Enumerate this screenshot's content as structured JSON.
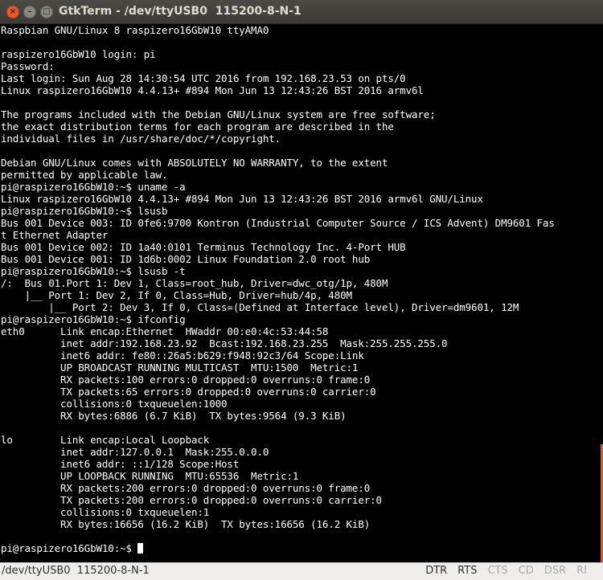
{
  "window": {
    "title": "GtkTerm - /dev/ttyUSB0  115200-8-N-1",
    "buttons": {
      "close": "×",
      "minimize": "–",
      "maximize": "□"
    }
  },
  "terminal": {
    "lines": [
      "Raspbian GNU/Linux 8 raspizero16GbW10 ttyAMA0",
      "",
      "raspizero16GbW10 login: pi",
      "Password:",
      "Last login: Sun Aug 28 14:30:54 UTC 2016 from 192.168.23.53 on pts/0",
      "Linux raspizero16GbW10 4.4.13+ #894 Mon Jun 13 12:43:26 BST 2016 armv6l",
      "",
      "The programs included with the Debian GNU/Linux system are free software;",
      "the exact distribution terms for each program are described in the",
      "individual files in /usr/share/doc/*/copyright.",
      "",
      "Debian GNU/Linux comes with ABSOLUTELY NO WARRANTY, to the extent",
      "permitted by applicable law.",
      "pi@raspizero16GbW10:~$ uname -a",
      "Linux raspizero16GbW10 4.4.13+ #894 Mon Jun 13 12:43:26 BST 2016 armv6l GNU/Linux",
      "pi@raspizero16GbW10:~$ lsusb",
      "Bus 001 Device 003: ID 0fe6:9700 Kontron (Industrial Computer Source / ICS Advent) DM9601 Fas",
      "t Ethernet Adapter",
      "Bus 001 Device 002: ID 1a40:0101 Terminus Technology Inc. 4-Port HUB",
      "Bus 001 Device 001: ID 1d6b:0002 Linux Foundation 2.0 root hub",
      "pi@raspizero16GbW10:~$ lsusb -t",
      "/:  Bus 01.Port 1: Dev 1, Class=root_hub, Driver=dwc_otg/1p, 480M",
      "    |__ Port 1: Dev 2, If 0, Class=Hub, Driver=hub/4p, 480M",
      "        |__ Port 2: Dev 3, If 0, Class=(Defined at Interface level), Driver=dm9601, 12M",
      "pi@raspizero16GbW10:~$ ifconfig",
      "eth0      Link encap:Ethernet  HWaddr 00:e0:4c:53:44:58",
      "          inet addr:192.168.23.92  Bcast:192.168.23.255  Mask:255.255.255.0",
      "          inet6 addr: fe80::26a5:b629:f948:92c3/64 Scope:Link",
      "          UP BROADCAST RUNNING MULTICAST  MTU:1500  Metric:1",
      "          RX packets:100 errors:0 dropped:0 overruns:0 frame:0",
      "          TX packets:65 errors:0 dropped:0 overruns:0 carrier:0",
      "          collisions:0 txqueuelen:1000",
      "          RX bytes:6886 (6.7 KiB)  TX bytes:9564 (9.3 KiB)",
      "",
      "lo        Link encap:Local Loopback",
      "          inet addr:127.0.0.1  Mask:255.0.0.0",
      "          inet6 addr: ::1/128 Scope:Host",
      "          UP LOOPBACK RUNNING  MTU:65536  Metric:1",
      "          RX packets:200 errors:0 dropped:0 overruns:0 frame:0",
      "          TX packets:200 errors:0 dropped:0 overruns:0 carrier:0",
      "          collisions:0 txqueuelen:1",
      "          RX bytes:16656 (16.2 KiB)  TX bytes:16656 (16.2 KiB)",
      ""
    ],
    "prompt": "pi@raspizero16GbW10:~$ "
  },
  "statusbar": {
    "port": "/dev/ttyUSB0  115200-8-N-1",
    "signals": [
      {
        "label": "DTR",
        "active": true
      },
      {
        "label": "RTS",
        "active": true
      },
      {
        "label": "CTS",
        "active": false
      },
      {
        "label": "CD",
        "active": false
      },
      {
        "label": "DSR",
        "active": false
      },
      {
        "label": "RI",
        "active": false
      }
    ]
  },
  "colors": {
    "terminal_bg": "#000000",
    "terminal_fg": "#ffffff",
    "titlebar_bg": "#3c3b37",
    "close_button": "#e9592c",
    "statusbar_bg": "#efeeec",
    "signal_on": "#2e2e2e",
    "signal_off": "#a9a7a3",
    "scroll_marker": "#e9542c"
  }
}
